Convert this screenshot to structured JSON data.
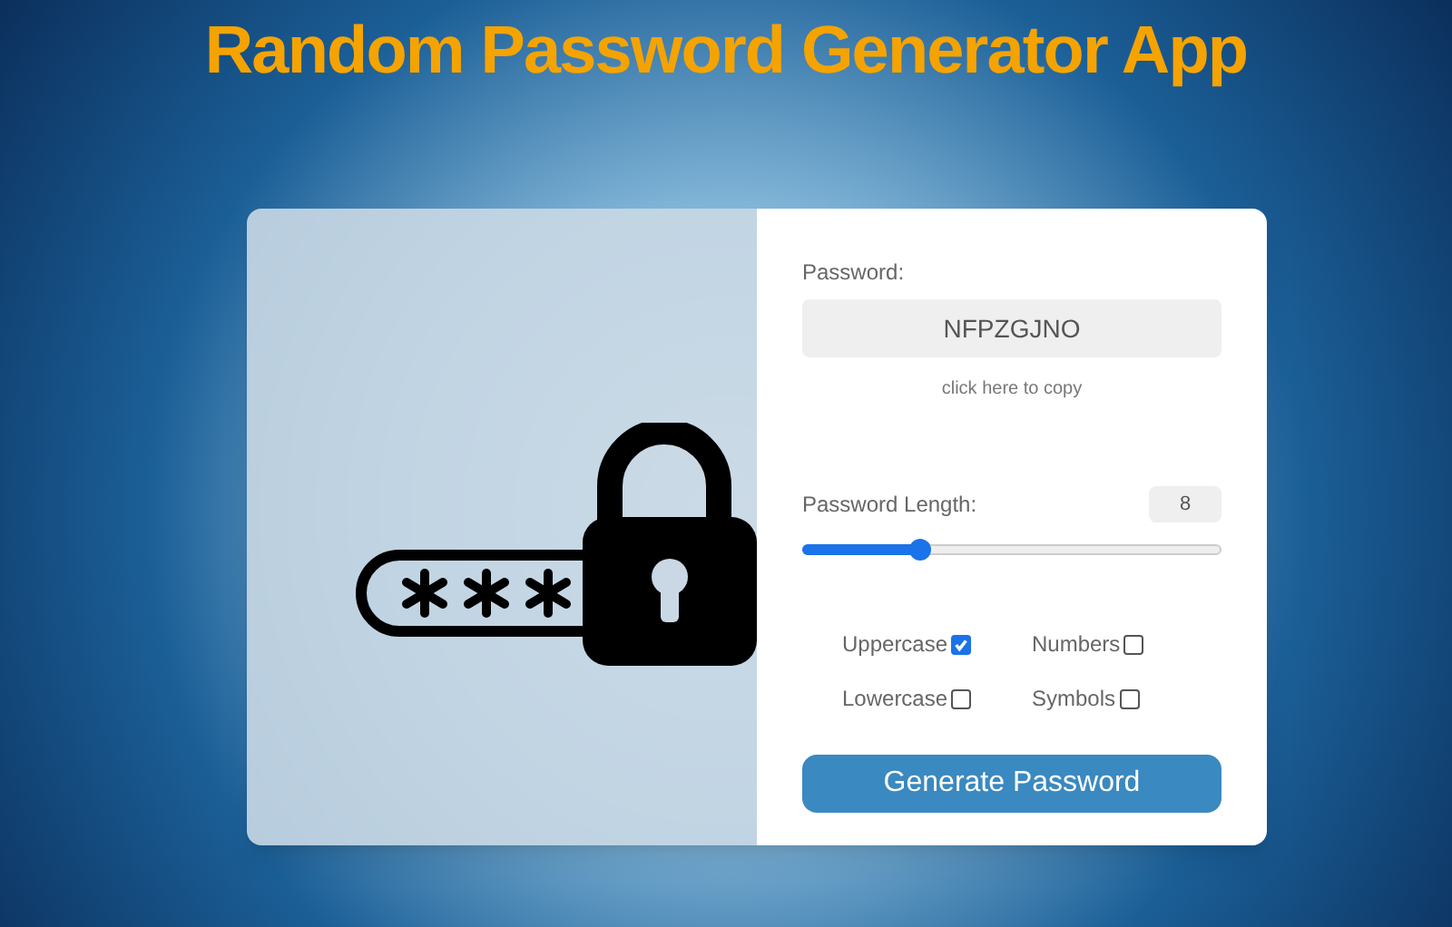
{
  "title": "Random Password Generator App",
  "password": {
    "label": "Password:",
    "value": "NFPZGJNO",
    "copy_hint": "click here to copy"
  },
  "length": {
    "label": "Password Length:",
    "value": "8",
    "level": 0.28
  },
  "options": [
    {
      "label": "Uppercase",
      "checked": true
    },
    {
      "label": "Numbers",
      "checked": false
    },
    {
      "label": "Lowercase",
      "checked": false
    },
    {
      "label": "Symbols",
      "checked": false
    }
  ],
  "button": "Generate Password"
}
